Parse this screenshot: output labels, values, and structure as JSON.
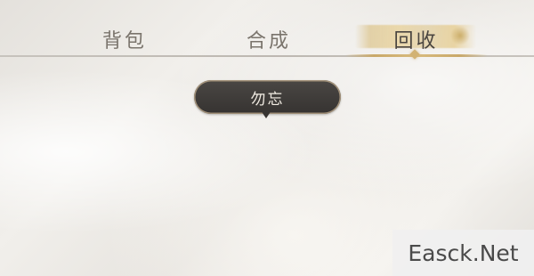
{
  "tabs": [
    {
      "label": "背包",
      "active": false
    },
    {
      "label": "合成",
      "active": false
    },
    {
      "label": "回收",
      "active": true
    }
  ],
  "tooltip": {
    "label": "勿忘"
  },
  "watermark": {
    "text": "Easck.Net"
  },
  "colors": {
    "accent_gold": "#c9a868",
    "tooltip_bg": "#3b3836",
    "tab_text": "#7a746c",
    "background": "#ece9e4"
  }
}
